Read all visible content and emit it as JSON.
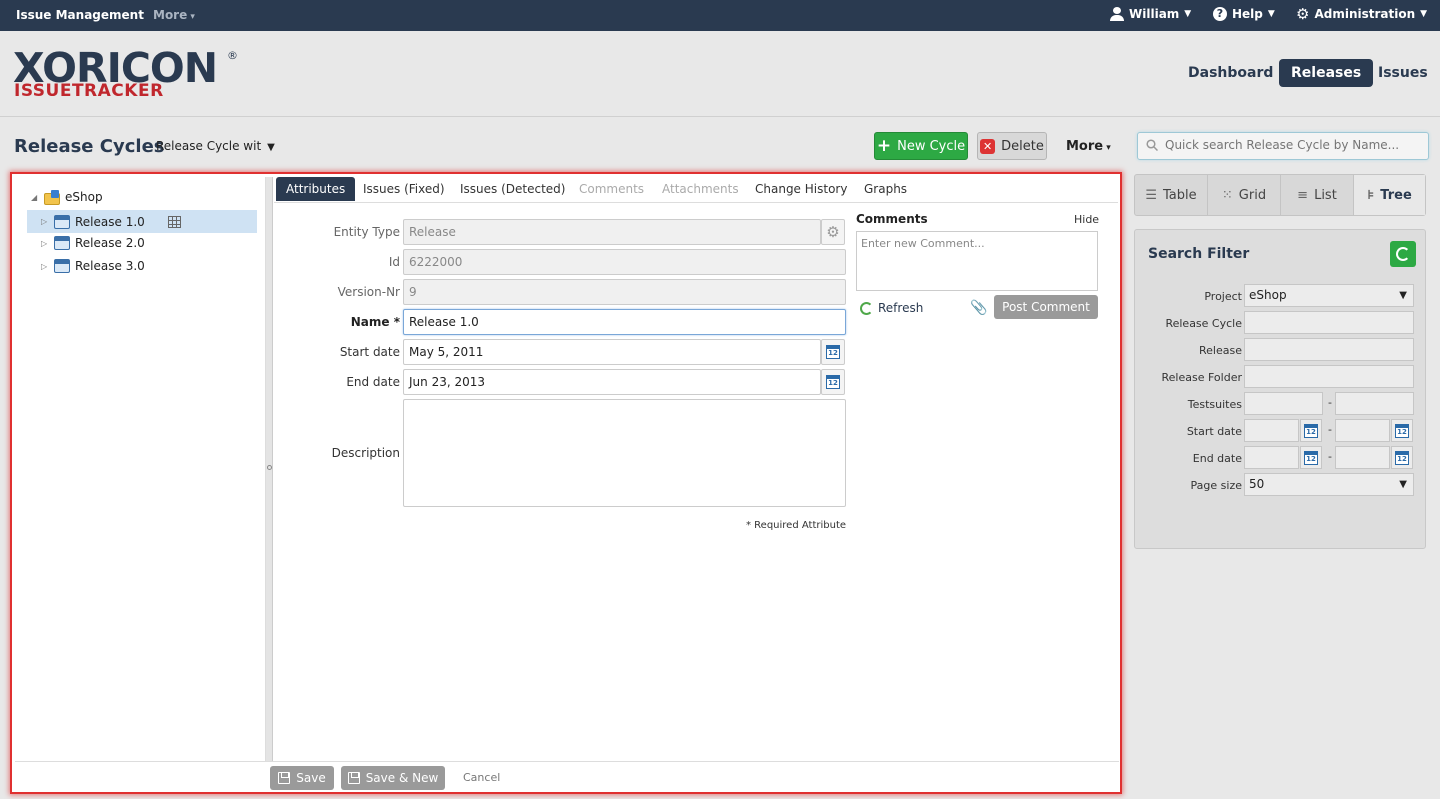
{
  "topbar": {
    "brand": "Issue Management",
    "more": "More",
    "user": "William",
    "help": "Help",
    "admin": "Administration"
  },
  "logo": {
    "main": "XORICON",
    "reg": "®",
    "sub": "ISSUETRACKER"
  },
  "mainnav": [
    "Dashboard",
    "Releases",
    "Issues"
  ],
  "page": {
    "title": "Release Cycles",
    "view_select": "Release Cycle wit",
    "new_button": "New Cycle",
    "delete_button": "Delete",
    "more_button": "More",
    "search_placeholder": "Quick search Release Cycle by Name..."
  },
  "tree": {
    "root": "eShop",
    "items": [
      "Release 1.0",
      "Release 2.0",
      "Release 3.0"
    ]
  },
  "tabs": [
    "Attributes",
    "Issues (Fixed)",
    "Issues (Detected)",
    "Comments",
    "Attachments",
    "Change History",
    "Graphs"
  ],
  "form": {
    "entity_type_label": "Entity Type",
    "entity_type": "Release",
    "id_label": "Id",
    "id": "6222000",
    "version_label": "Version-Nr",
    "version": "9",
    "name_label": "Name",
    "name": "Release 1.0",
    "start_label": "Start date",
    "start": "May 5, 2011",
    "end_label": "End date",
    "end": "Jun 23, 2013",
    "description_label": "Description",
    "required_note": "* Required Attribute"
  },
  "comments": {
    "title": "Comments",
    "hide": "Hide",
    "placeholder": "Enter new Comment...",
    "refresh": "Refresh",
    "post": "Post Comment"
  },
  "footer": {
    "save": "Save",
    "save_new": "Save & New",
    "cancel": "Cancel"
  },
  "views": [
    "Table",
    "Grid",
    "List",
    "Tree"
  ],
  "filter": {
    "title": "Search Filter",
    "project_label": "Project",
    "project": "eShop",
    "release_cycle_label": "Release Cycle",
    "release_label": "Release",
    "release_folder_label": "Release Folder",
    "testsuites_label": "Testsuites",
    "start_label": "Start date",
    "end_label": "End date",
    "page_size_label": "Page size",
    "page_size": "50"
  },
  "colors": {
    "navy": "#2a3a50",
    "brand_red": "#c0272d",
    "green": "#2da944",
    "highlight_border": "#e03030"
  }
}
